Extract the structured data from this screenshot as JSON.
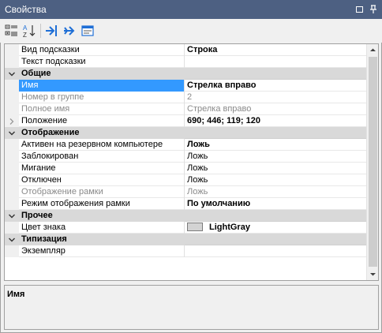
{
  "window": {
    "title": "Свойства"
  },
  "toolbar": {
    "buttons": [
      {
        "name": "categorized-view-icon"
      },
      {
        "name": "sort-alphabetical-icon"
      },
      {
        "name": "goto-icon"
      },
      {
        "name": "forward-icon"
      },
      {
        "name": "property-pages-icon"
      }
    ]
  },
  "grid": {
    "rows": [
      {
        "kind": "prop",
        "label": "Вид подсказки",
        "value": "Строка",
        "bold": true
      },
      {
        "kind": "prop",
        "label": "Текст подсказки",
        "value": ""
      },
      {
        "kind": "cat",
        "label": "Общие"
      },
      {
        "kind": "prop",
        "label": "Имя",
        "value": "Стрелка вправо",
        "selected": true
      },
      {
        "kind": "prop",
        "label": "Номер в группе",
        "value": "2",
        "dim": true
      },
      {
        "kind": "prop",
        "label": "Полное имя",
        "value": "Стрелка вправо",
        "dim": true
      },
      {
        "kind": "prop",
        "label": "Положение",
        "value": "690; 446; 119; 120",
        "bold": true,
        "expandable": true
      },
      {
        "kind": "cat",
        "label": "Отображение"
      },
      {
        "kind": "prop",
        "label": "Активен на резервном компьютере",
        "value": "Ложь",
        "bold": true
      },
      {
        "kind": "prop",
        "label": "Заблокирован",
        "value": "Ложь"
      },
      {
        "kind": "prop",
        "label": "Мигание",
        "value": "Ложь"
      },
      {
        "kind": "prop",
        "label": "Отключен",
        "value": "Ложь"
      },
      {
        "kind": "prop",
        "label": "Отображение рамки",
        "value": "Ложь",
        "dim": true
      },
      {
        "kind": "prop",
        "label": "Режим отображения рамки",
        "value": "По умолчанию",
        "bold": true
      },
      {
        "kind": "cat",
        "label": "Прочее"
      },
      {
        "kind": "prop",
        "label": "Цвет знака",
        "value": "LightGray",
        "bold": true,
        "swatch": "#d3d3d3"
      },
      {
        "kind": "cat",
        "label": "Типизация"
      },
      {
        "kind": "prop",
        "label": "Экземпляр",
        "value": ""
      }
    ]
  },
  "description": {
    "title": "Имя"
  },
  "colors": {
    "titlebar": "#4d6082",
    "selection": "#3399ff",
    "category": "#d9d9d9",
    "toolbar_blue": "#1f6fd6"
  }
}
